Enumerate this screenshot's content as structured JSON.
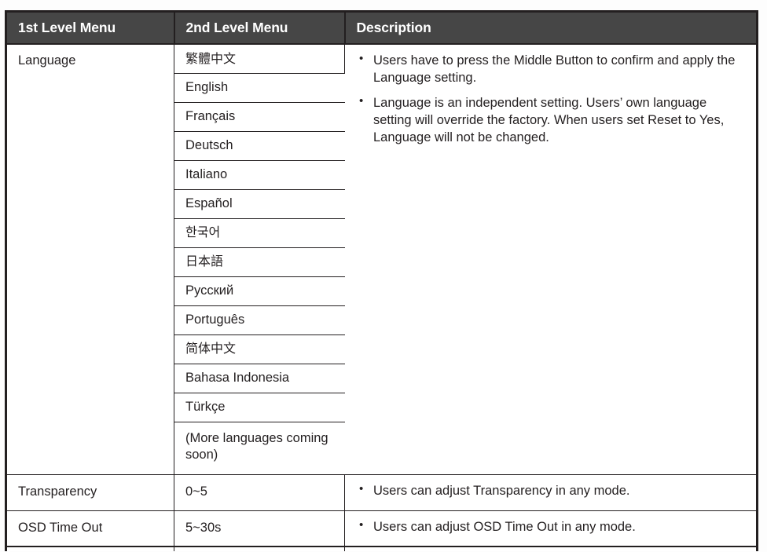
{
  "table": {
    "headers": [
      "1st Level Menu",
      "2nd Level Menu",
      "Description"
    ],
    "rows": [
      {
        "menu1": "Language",
        "submenus": [
          "繁體中文",
          "English",
          "Français",
          "Deutsch",
          "Italiano",
          "Español",
          "한국어",
          "日本語",
          "Русский",
          "Português",
          "简体中文",
          "Bahasa Indonesia",
          "Türkçe",
          "(More languages coming soon)"
        ],
        "description": [
          "Users have to press the Middle Button to confirm and apply the Language setting.",
          "Language is an independent setting. Users’ own language setting will override the factory. When users set Reset to Yes, Language will not be changed."
        ]
      },
      {
        "menu1": "Transparency",
        "menu2": "0~5",
        "description": [
          "Users can adjust Transparency in any mode."
        ]
      },
      {
        "menu1": "OSD Time Out",
        "menu2": "5~30s",
        "description": [
          "Users can adjust OSD Time Out in any mode."
        ]
      }
    ]
  },
  "colors": {
    "header_bg": "#464646",
    "header_text": "#ffffff",
    "border": "#231f20",
    "body_text": "#231f20",
    "page_bg": "#ffffff"
  }
}
